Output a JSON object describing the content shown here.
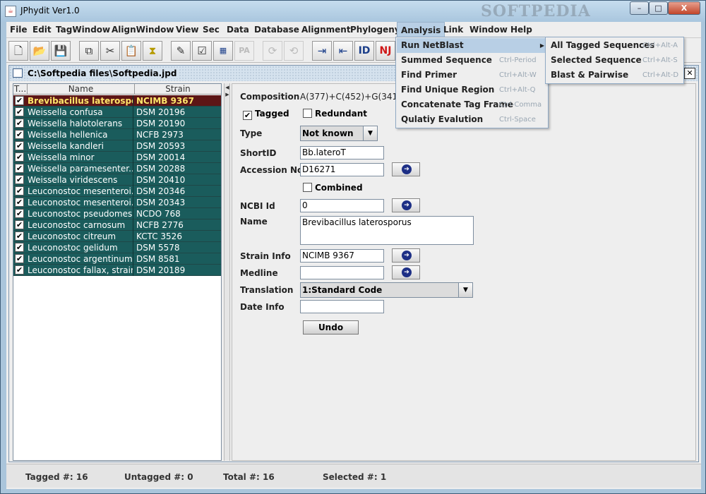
{
  "window": {
    "title": "JPhydit Ver1.0",
    "watermark": "SOFTPEDIA",
    "controls": [
      "–",
      "□",
      "X"
    ]
  },
  "menubar": [
    "File",
    "Edit",
    "TagWindow",
    "AlignWindow",
    "View",
    "Sec",
    "Data",
    "Database",
    "Alignment",
    "Phylogeny",
    "Analysis",
    "Link",
    "Window",
    "Help"
  ],
  "toolbar": [
    "new-file-icon",
    "open-folder-icon",
    "save-icon",
    "copy-icon",
    "cut-icon",
    "paste-icon",
    "hourglass-icon",
    "edit-icon",
    "checklist-icon",
    "align-icon",
    "pa-icon",
    "refresh-icon",
    "refresh-alt-icon",
    "import-icon",
    "export-icon",
    "id-icon",
    "nj-icon"
  ],
  "toolbar_text": {
    "pa": "PA",
    "id": "ID",
    "nj": "NJ"
  },
  "document": {
    "path": "C:\\Softpedia files\\Softpedia.jpd"
  },
  "table": {
    "headers": [
      "T...",
      "Name",
      "Strain"
    ],
    "rows": [
      {
        "name": "Brevibacillus laterosporus",
        "strain": "NCIMB 9367"
      },
      {
        "name": "Weissella confusa",
        "strain": "DSM 20196"
      },
      {
        "name": "Weissella halotolerans",
        "strain": "DSM 20190"
      },
      {
        "name": "Weissella hellenica",
        "strain": "NCFB 2973"
      },
      {
        "name": "Weissella kandleri",
        "strain": "DSM 20593"
      },
      {
        "name": "Weissella minor",
        "strain": "DSM 20014"
      },
      {
        "name": "Weissella paramesenter...",
        "strain": "DSM 20288"
      },
      {
        "name": "Weissella viridescens",
        "strain": "DSM 20410"
      },
      {
        "name": "Leuconostoc mesenteroi...",
        "strain": "DSM 20346"
      },
      {
        "name": "Leuconostoc mesenteroi...",
        "strain": "DSM 20343"
      },
      {
        "name": "Leuconostoc pseudomes...",
        "strain": "NCDO 768"
      },
      {
        "name": "Leuconostoc carnosum",
        "strain": "NCFB 2776"
      },
      {
        "name": "Leuconostoc citreum",
        "strain": "KCTC 3526"
      },
      {
        "name": "Leuconostoc gelidum",
        "strain": "DSM 5578"
      },
      {
        "name": "Leuconostoc argentinum",
        "strain": "DSM 8581"
      },
      {
        "name": "Leuconostoc fallax, strain...",
        "strain": "DSM 20189"
      }
    ]
  },
  "form": {
    "composition_label": "Composition",
    "composition_value": "A(377)+C(452)+G(341)+T(",
    "tagged_label": "Tagged",
    "redundant_label": "Redundant",
    "type_label": "Type",
    "type_value": "Not known",
    "shortid_label": "ShortID",
    "shortid_value": "Bb.lateroT",
    "accession_label": "Accession No",
    "accession_value": "D16271",
    "combined_label": "Combined",
    "ncbi_label": "NCBI Id",
    "ncbi_value": "0",
    "name_label": "Name",
    "name_value": "Brevibacillus laterosporus",
    "strain_label": "Strain Info",
    "strain_value": "NCIMB 9367",
    "medline_label": "Medline",
    "medline_value": "",
    "translation_label": "Translation",
    "translation_value": "1:Standard Code",
    "date_label": "Date Info",
    "date_value": "",
    "undo_label": "Undo"
  },
  "status": {
    "tagged": "Tagged #: 16",
    "untagged": "Untagged #: 0",
    "total": "Total #: 16",
    "selected": "Selected #: 1"
  },
  "analysis_menu": [
    {
      "label": "Run NetBlast",
      "shortcut": ""
    },
    {
      "label": "Summed Sequence",
      "shortcut": "Ctrl-Period"
    },
    {
      "label": "Find Primer",
      "shortcut": "Ctrl+Alt-W"
    },
    {
      "label": "Find Unique Region",
      "shortcut": "Ctrl+Alt-Q"
    },
    {
      "label": "Concatenate Tag Frame",
      "shortcut": "Ctrl-Comma"
    },
    {
      "label": "Qulatiy Evalution",
      "shortcut": "Ctrl-Space"
    }
  ],
  "netblast_submenu": [
    {
      "label": "All Tagged Sequences",
      "shortcut": "Ctrl+Alt-A"
    },
    {
      "label": "Selected Sequence",
      "shortcut": "Ctrl+Alt-S"
    },
    {
      "label": "Blast & Pairwise",
      "shortcut": "Ctrl+Alt-D"
    }
  ],
  "colors": {
    "row_bg": "#1a5c5c",
    "selected_row_bg": "#5d1616",
    "selected_row_text": "#ffe66b",
    "menu_highlight": "#b8cfe5"
  }
}
